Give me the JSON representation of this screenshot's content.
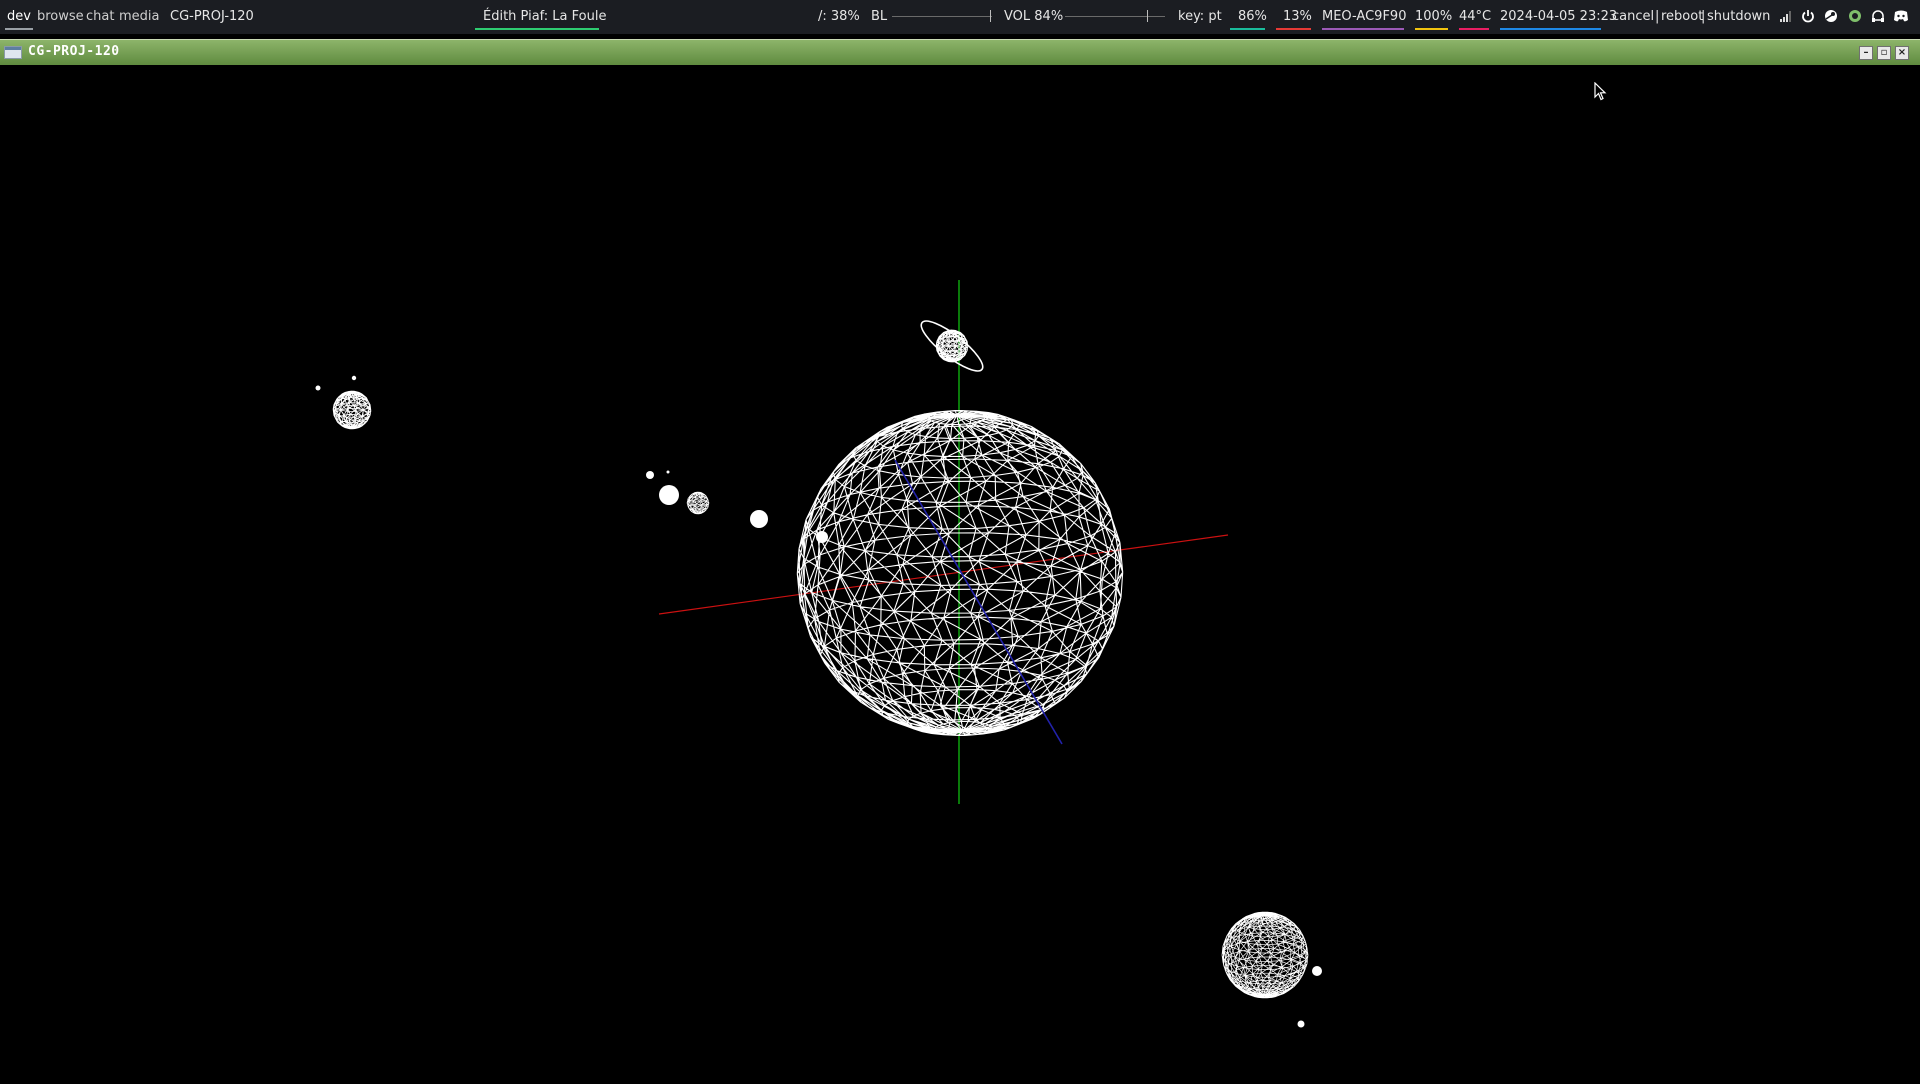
{
  "topbar": {
    "workspaces": [
      {
        "label": "dev",
        "active": true
      },
      {
        "label": "browse",
        "active": false
      },
      {
        "label": "chat",
        "active": false
      },
      {
        "label": "media",
        "active": false
      }
    ],
    "window_name": "CG-PROJ-120",
    "now_playing": "Édith Piaf: La Foule",
    "disk": "/: 38%",
    "backlight_label": "BL",
    "backlight_level": 1.0,
    "volume_label": "VOL 84%",
    "volume_level": 0.84,
    "keyboard": "key: pt",
    "cpu": "86%",
    "mem": "13%",
    "wifi": "MEO-AC9F90",
    "battery": "100%",
    "temp": "44°C",
    "datetime": "2024-04-05 23:23",
    "session": {
      "cancel": "cancel",
      "sep": "|",
      "reboot": "reboot",
      "shutdown": "shutdown"
    },
    "tray_icons": [
      "signal-icon",
      "power-icon",
      "steam-icon",
      "headset-icon",
      "bell-icon",
      "discord-icon"
    ],
    "colors": {
      "workspace_underline": "#9aa0a6",
      "now_playing_underline": "#2ecc71",
      "cpu_underline": "#1abc9c",
      "mem_underline": "#e53935",
      "wifi_underline": "#9b59b6",
      "battery_underline": "#f1c40f",
      "temp_underline": "#e91e63",
      "datetime_underline": "#1e88e5"
    }
  },
  "window": {
    "title": "CG-PROJ-120",
    "titlebar_color": "#6f9a4c",
    "buttons": [
      "minimize-button",
      "maximize-button",
      "close-button"
    ]
  },
  "scene": {
    "background": "#000000",
    "x_axis_color": "#cc1111",
    "y_axis_color": "#11cc11",
    "z_axis_color": "#2222aa",
    "wireframe_color": "#ffffff",
    "bodies": [
      "central-planet",
      "ringed-moon",
      "left-planet",
      "lower-right-planet",
      "small-moons"
    ]
  }
}
